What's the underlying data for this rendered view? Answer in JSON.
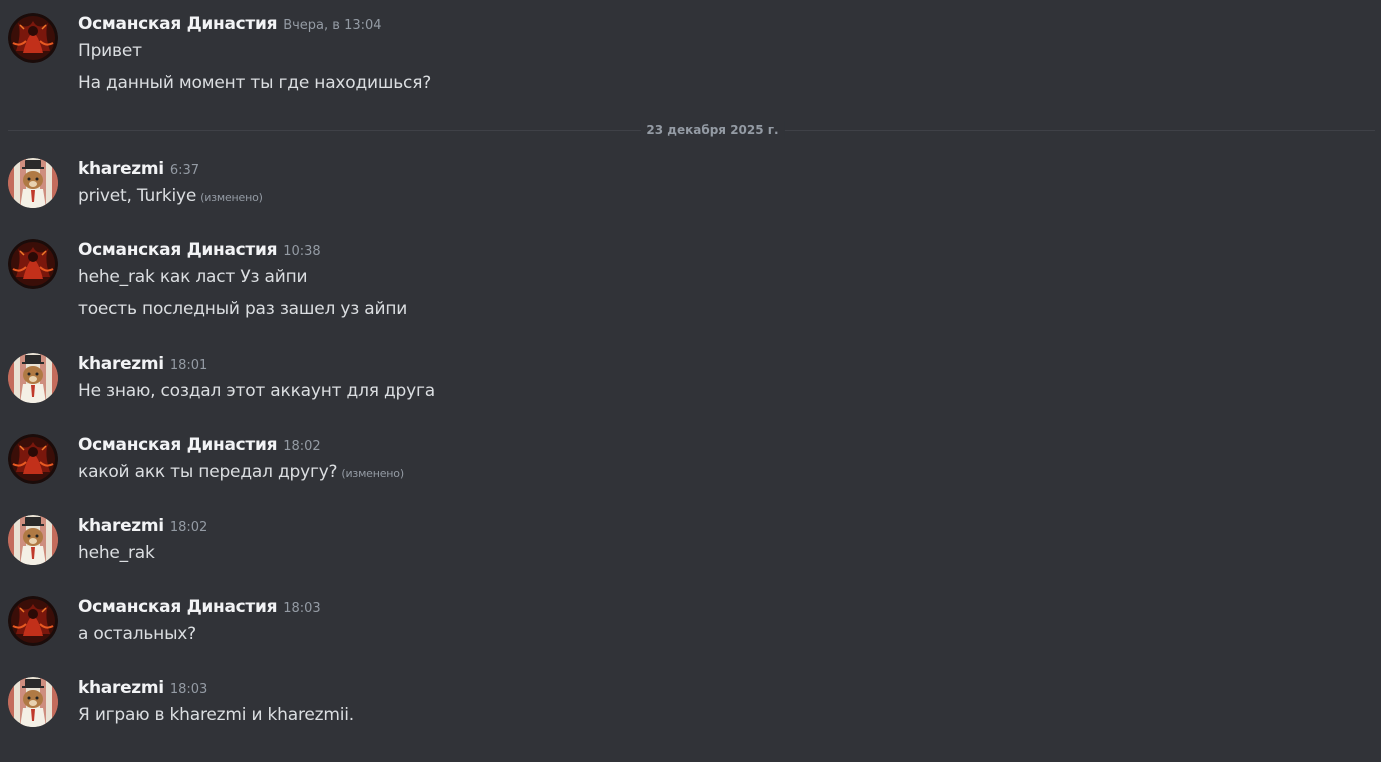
{
  "divider": {
    "label": "23 декабря 2025 г."
  },
  "colors": {
    "background": "#313338",
    "username": "#f2f3f5",
    "message_text": "#dbdee1",
    "muted": "#949ba4",
    "divider_line": "#3f4147"
  },
  "groups": [
    {
      "author": "Османская Династия",
      "avatar_icon": "ottoman-dynasty-avatar",
      "time": "Вчера, в 13:04",
      "messages": [
        {
          "text": "Привет",
          "edited": ""
        },
        {
          "text": "На данный момент ты где находишься?",
          "edited": ""
        }
      ]
    },
    {
      "author": "kharezmi",
      "avatar_icon": "kharezmi-avatar",
      "time": "6:37",
      "messages": [
        {
          "text": "privet, Turkiye",
          "edited": "(изменено)"
        }
      ]
    },
    {
      "author": "Османская Династия",
      "avatar_icon": "ottoman-dynasty-avatar",
      "time": "10:38",
      "messages": [
        {
          "text": "hehe_rak как ласт Уз айпи",
          "edited": ""
        },
        {
          "text": "тоесть последный раз зашел уз айпи",
          "edited": ""
        }
      ]
    },
    {
      "author": "kharezmi",
      "avatar_icon": "kharezmi-avatar",
      "time": "18:01",
      "messages": [
        {
          "text": "Не знаю, создал этот аккаунт для друга",
          "edited": ""
        }
      ]
    },
    {
      "author": "Османская Династия",
      "avatar_icon": "ottoman-dynasty-avatar",
      "time": "18:02",
      "messages": [
        {
          "text": "какой акк ты передал другу?",
          "edited": "(изменено)"
        }
      ]
    },
    {
      "author": "kharezmi",
      "avatar_icon": "kharezmi-avatar",
      "time": "18:02",
      "messages": [
        {
          "text": "hehe_rak",
          "edited": ""
        }
      ]
    },
    {
      "author": "Османская Династия",
      "avatar_icon": "ottoman-dynasty-avatar",
      "time": "18:03",
      "messages": [
        {
          "text": "а остальных?",
          "edited": ""
        }
      ]
    },
    {
      "author": "kharezmi",
      "avatar_icon": "kharezmi-avatar",
      "time": "18:03",
      "messages": [
        {
          "text": "Я играю в kharezmi и kharezmii.",
          "edited": ""
        }
      ]
    }
  ]
}
